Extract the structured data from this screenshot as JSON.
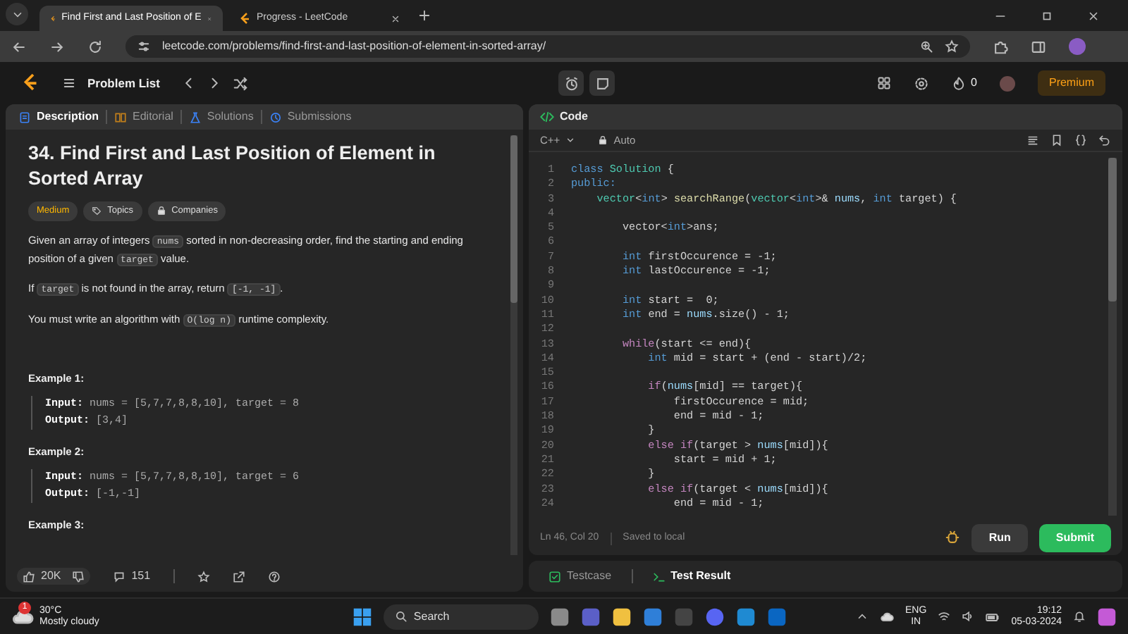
{
  "browser": {
    "tabs": [
      {
        "title": "Find First and Last Position of E",
        "selected": true
      },
      {
        "title": "Progress - LeetCode",
        "selected": false
      }
    ],
    "url": "leetcode.com/problems/find-first-and-last-position-of-element-in-sorted-array/"
  },
  "nav": {
    "problem_list": "Problem List",
    "streak": "0",
    "premium": "Premium"
  },
  "description_panel": {
    "tabs": [
      {
        "label": "Description",
        "kind": "description",
        "selected": true
      },
      {
        "label": "Editorial",
        "kind": "editorial",
        "selected": false
      },
      {
        "label": "Solutions",
        "kind": "solutions",
        "selected": false
      },
      {
        "label": "Submissions",
        "kind": "submissions",
        "selected": false
      }
    ],
    "title": "34. Find First and Last Position of Element in Sorted Array",
    "tags": [
      {
        "label": "Medium",
        "kind": "difficulty"
      },
      {
        "label": "Topics",
        "kind": "topics"
      },
      {
        "label": "Companies",
        "kind": "companies"
      }
    ],
    "paragraphs": [
      {
        "segments": [
          {
            "text": "Given an array of integers ",
            "code": false
          },
          {
            "text": "nums",
            "code": true
          },
          {
            "text": " sorted in non-decreasing order, find the starting and ending position of a given ",
            "code": false
          },
          {
            "text": "target",
            "code": true
          },
          {
            "text": " value.",
            "code": false
          }
        ]
      },
      {
        "segments": [
          {
            "text": "If ",
            "code": false
          },
          {
            "text": "target",
            "code": true
          },
          {
            "text": " is not found in the array, return ",
            "code": false
          },
          {
            "text": "[-1, -1]",
            "code": true
          },
          {
            "text": ".",
            "code": false
          }
        ]
      },
      {
        "segments": [
          {
            "text": "You must write an algorithm with ",
            "code": false
          },
          {
            "text": "O(log n)",
            "code": true
          },
          {
            "text": " runtime complexity.",
            "code": false
          }
        ]
      }
    ],
    "examples": [
      {
        "title": "Example 1:",
        "lines": [
          {
            "label": "Input:",
            "value": "nums = [5,7,7,8,8,10], target = 8"
          },
          {
            "label": "Output:",
            "value": "[3,4]"
          }
        ]
      },
      {
        "title": "Example 2:",
        "lines": [
          {
            "label": "Input:",
            "value": "nums = [5,7,7,8,8,10], target = 6"
          },
          {
            "label": "Output:",
            "value": "[-1,-1]"
          }
        ]
      },
      {
        "title": "Example 3:"
      }
    ],
    "likes": "20K",
    "comments": "151"
  },
  "code_panel": {
    "title": "Code",
    "language": "C++",
    "mode": "Auto",
    "lines": [
      {
        "number": "1",
        "tokens": [
          {
            "text": "class ",
            "kind": "keyword"
          },
          {
            "text": "Solution",
            "kind": "type"
          },
          {
            "text": " {",
            "kind": "plain"
          }
        ]
      },
      {
        "number": "2",
        "tokens": [
          {
            "text": "public:",
            "kind": "keyword"
          }
        ]
      },
      {
        "number": "3",
        "tokens": [
          {
            "text": "    vector",
            "kind": "type"
          },
          {
            "text": "<",
            "kind": "plain"
          },
          {
            "text": "int",
            "kind": "keyword"
          },
          {
            "text": "> ",
            "kind": "plain"
          },
          {
            "text": "searchRange",
            "kind": "func"
          },
          {
            "text": "(",
            "kind": "plain"
          },
          {
            "text": "vector",
            "kind": "type"
          },
          {
            "text": "<",
            "kind": "plain"
          },
          {
            "text": "int",
            "kind": "keyword"
          },
          {
            "text": ">& ",
            "kind": "plain"
          },
          {
            "text": "nums",
            "kind": "var"
          },
          {
            "text": ", ",
            "kind": "plain"
          },
          {
            "text": "int",
            "kind": "keyword"
          },
          {
            "text": " target) {",
            "kind": "plain"
          }
        ]
      },
      {
        "number": "4"
      },
      {
        "number": "5",
        "tokens": [
          {
            "text": "        vector<",
            "kind": "plain"
          },
          {
            "text": "int",
            "kind": "keyword"
          },
          {
            "text": ">ans;",
            "kind": "plain"
          }
        ]
      },
      {
        "number": "6"
      },
      {
        "number": "7",
        "tokens": [
          {
            "text": "        int",
            "kind": "keyword"
          },
          {
            "text": " firstOccurence = -1;",
            "kind": "plain"
          }
        ]
      },
      {
        "number": "8",
        "tokens": [
          {
            "text": "        int",
            "kind": "keyword"
          },
          {
            "text": " lastOccurence = -1;",
            "kind": "plain"
          }
        ]
      },
      {
        "number": "9"
      },
      {
        "number": "10",
        "tokens": [
          {
            "text": "        int",
            "kind": "keyword"
          },
          {
            "text": " start =  0;",
            "kind": "plain"
          }
        ]
      },
      {
        "number": "11",
        "tokens": [
          {
            "text": "        int",
            "kind": "keyword"
          },
          {
            "text": " end = ",
            "kind": "plain"
          },
          {
            "text": "nums",
            "kind": "var"
          },
          {
            "text": ".size() - 1;",
            "kind": "plain"
          }
        ]
      },
      {
        "number": "12"
      },
      {
        "number": "13",
        "tokens": [
          {
            "text": "        while",
            "kind": "control"
          },
          {
            "text": "(start <= end){",
            "kind": "plain"
          }
        ]
      },
      {
        "number": "14",
        "tokens": [
          {
            "text": "            int",
            "kind": "keyword"
          },
          {
            "text": " mid = start + (end - start)/2;",
            "kind": "plain"
          }
        ]
      },
      {
        "number": "15"
      },
      {
        "number": "16",
        "tokens": [
          {
            "text": "            if",
            "kind": "control"
          },
          {
            "text": "(",
            "kind": "plain"
          },
          {
            "text": "nums",
            "kind": "var"
          },
          {
            "text": "[mid] == target){",
            "kind": "plain"
          }
        ]
      },
      {
        "number": "17",
        "tokens": [
          {
            "text": "                firstOccurence = mid;",
            "kind": "plain"
          }
        ]
      },
      {
        "number": "18",
        "tokens": [
          {
            "text": "                end = mid - 1;",
            "kind": "plain"
          }
        ]
      },
      {
        "number": "19",
        "tokens": [
          {
            "text": "            }",
            "kind": "plain"
          }
        ]
      },
      {
        "number": "20",
        "tokens": [
          {
            "text": "            else if",
            "kind": "control"
          },
          {
            "text": "(target > ",
            "kind": "plain"
          },
          {
            "text": "nums",
            "kind": "var"
          },
          {
            "text": "[mid]){",
            "kind": "plain"
          }
        ]
      },
      {
        "number": "21",
        "tokens": [
          {
            "text": "                start = mid + 1;",
            "kind": "plain"
          }
        ]
      },
      {
        "number": "22",
        "tokens": [
          {
            "text": "            }",
            "kind": "plain"
          }
        ]
      },
      {
        "number": "23",
        "tokens": [
          {
            "text": "            else if",
            "kind": "control"
          },
          {
            "text": "(target < ",
            "kind": "plain"
          },
          {
            "text": "nums",
            "kind": "var"
          },
          {
            "text": "[mid]){",
            "kind": "plain"
          }
        ]
      },
      {
        "number": "24",
        "tokens": [
          {
            "text": "                end = mid - 1;",
            "kind": "plain"
          }
        ]
      }
    ],
    "cursor": "Ln 46, Col 20",
    "save_status": "Saved to local",
    "run": "Run",
    "submit": "Submit"
  },
  "result_tabs": [
    {
      "label": "Testcase",
      "kind": "testcase",
      "selected": false
    },
    {
      "label": "Test Result",
      "kind": "result",
      "selected": true
    }
  ],
  "taskbar": {
    "temperature": "30°C",
    "weather": "Mostly cloudy",
    "weather_badge": "1",
    "search": "Search",
    "language": "ENG",
    "region": "IN",
    "time": "19:12",
    "date": "05-03-2024"
  }
}
